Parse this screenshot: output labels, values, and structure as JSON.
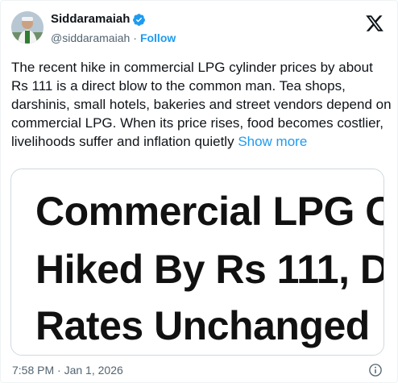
{
  "author": {
    "display_name": "Siddaramaiah",
    "handle": "@siddaramaiah",
    "separator": "·",
    "follow_label": "Follow",
    "avatar_icon": "profile-photo",
    "verified_icon": "verified-badge-icon"
  },
  "tweet": {
    "text": "The recent hike in commercial LPG cylinder prices by about Rs 111 is a direct blow to the common man. Tea shops, darshinis, small hotels, bakeries and street vendors depend on commercial LPG. When its price rises, food becomes costlier, livelihoods suffer and inflation quietly ",
    "show_more_label": "Show more"
  },
  "media": {
    "lines": [
      "Commercial LPG C",
      "Hiked By Rs 111, D",
      "Rates Unchanged"
    ]
  },
  "meta": {
    "time": "7:58 PM",
    "separator": "·",
    "date": "Jan 1, 2026"
  },
  "icons": {
    "brand": "x-logo-icon",
    "info": "info-icon"
  },
  "colors": {
    "accent": "#1d9bf0",
    "text": "#0f1419",
    "secondary": "#536471",
    "border": "#cfd9de"
  }
}
